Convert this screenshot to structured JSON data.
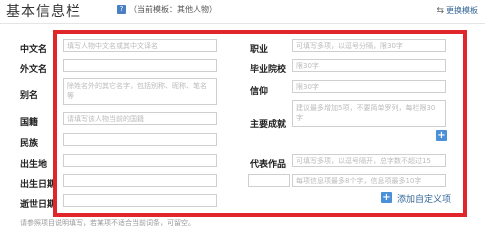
{
  "header": {
    "title": "基本信息栏",
    "template_hint": "（当前模板：其他人物）",
    "change_template": "更换模板",
    "help_icon": "question-icon",
    "swap_icon": "swap-icon"
  },
  "left": [
    {
      "label": "中文名",
      "placeholder": "填写人物中文名或其中文译名"
    },
    {
      "label": "外文名",
      "placeholder": ""
    },
    {
      "label": "别名",
      "placeholder": "除姓名外的其它名字，包括别称、昵称、笔名等"
    },
    {
      "label": "国籍",
      "placeholder": "请填写该人物当前的国籍"
    },
    {
      "label": "民族",
      "placeholder": ""
    },
    {
      "label": "出生地",
      "placeholder": ""
    },
    {
      "label": "出生日期",
      "placeholder": ""
    },
    {
      "label": "逝世日期",
      "placeholder": ""
    }
  ],
  "right": [
    {
      "label": "职业",
      "placeholder": "可填写多项，以逗号分隔，限30字"
    },
    {
      "label": "毕业院校",
      "placeholder": "限30字"
    },
    {
      "label": "信仰",
      "placeholder": "限30字"
    },
    {
      "label": "主要成就",
      "placeholder": "建议最多增加5项，不要简单罗列，每栏限30字"
    },
    {
      "label": "代表作品",
      "placeholder": "可填写多项，以逗号隔开，总字数不超过15"
    }
  ],
  "custom_field": {
    "placeholder": "每项信息项最多8个字，信息项最多10字"
  },
  "add_custom": "添加自定义项",
  "footer_note": "请参照项目说明填写，若某项不适合当前词条，可留空。",
  "colors": {
    "highlight": "#e0252b",
    "accent": "#4a90d9"
  }
}
